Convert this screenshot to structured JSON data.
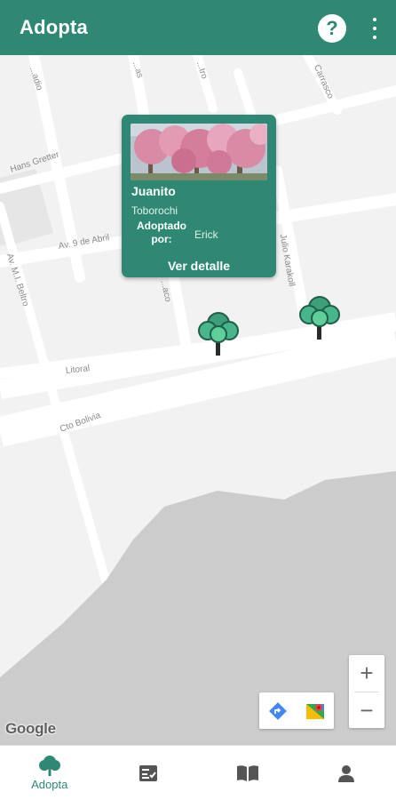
{
  "app_bar": {
    "title": "Adopta",
    "help_label": "?",
    "accent_color": "#2e8873"
  },
  "map": {
    "streets": {
      "s1": "...adio",
      "s2": "...as",
      "s3": "...tro",
      "s4": "Carrasco",
      "s5": "Hans Gretter",
      "s6": "Av. 9 de Abril",
      "s7": "Av. M.I. Beltro",
      "s8": "Julio Karakoll",
      "s9": "...aco",
      "s10": "Litoral",
      "s11": "Cto Bolivia"
    },
    "attribution": "Google",
    "zoom_in_label": "+",
    "zoom_out_label": "−"
  },
  "info_card": {
    "name": "Juanito",
    "species": "Toborochi",
    "adopted_by_label": "Adoptado por:",
    "adopted_by_value": "Erick",
    "detail_link": "Ver detalle",
    "photo_icon": "pink-flowering-tree-photo"
  },
  "markers": [
    {
      "icon": "tree-marker-icon"
    },
    {
      "icon": "tree-marker-icon"
    }
  ],
  "bottom_nav": {
    "items": [
      {
        "label": "Adopta",
        "icon": "tree-icon",
        "active": true
      },
      {
        "label": "",
        "icon": "checklist-icon",
        "active": false
      },
      {
        "label": "",
        "icon": "book-icon",
        "active": false
      },
      {
        "label": "",
        "icon": "person-icon",
        "active": false
      }
    ]
  }
}
